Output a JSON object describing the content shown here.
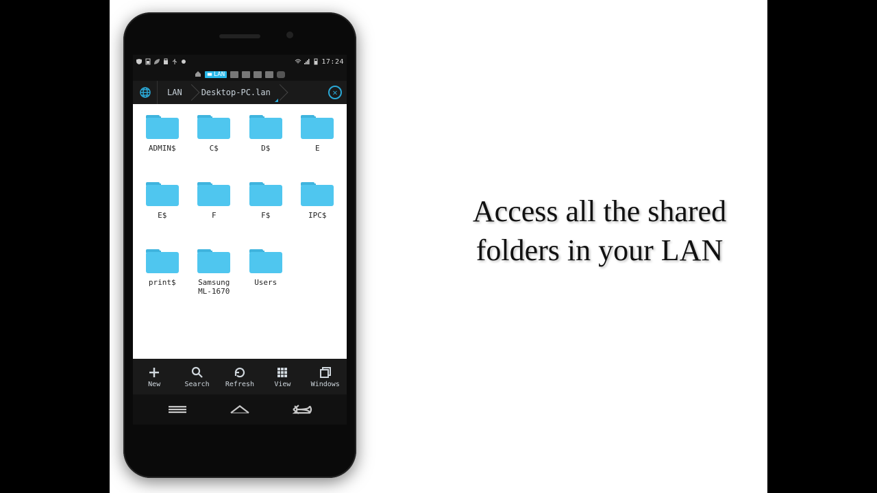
{
  "promo": {
    "line1": "Access  all the shared",
    "line2": "folders in your LAN"
  },
  "statusbar": {
    "time": "17:24"
  },
  "tabs": {
    "active_label": "LAN"
  },
  "breadcrumb": {
    "items": [
      "LAN",
      "Desktop-PC.lan"
    ]
  },
  "folders": [
    {
      "name": "ADMIN$"
    },
    {
      "name": "C$"
    },
    {
      "name": "D$"
    },
    {
      "name": "E"
    },
    {
      "name": "E$"
    },
    {
      "name": "F"
    },
    {
      "name": "F$"
    },
    {
      "name": "IPC$"
    },
    {
      "name": "print$"
    },
    {
      "name": "Samsung ML-1670"
    },
    {
      "name": "Users"
    }
  ],
  "toolbar": {
    "new": "New",
    "search": "Search",
    "refresh": "Refresh",
    "view": "View",
    "windows": "Windows"
  },
  "colors": {
    "folder": "#4fc6ef",
    "folder_tab": "#3fb4de",
    "accent": "#2aa8d6"
  }
}
